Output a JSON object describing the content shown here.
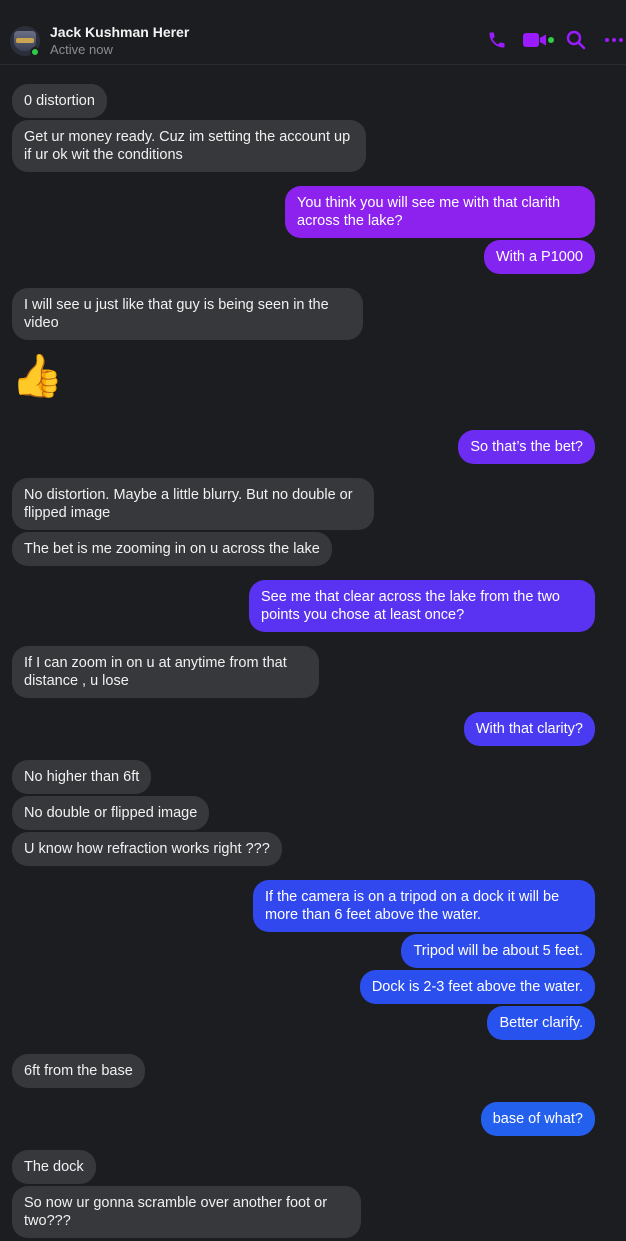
{
  "contact": {
    "name": "Jack Kushman Herer",
    "status": "Active now"
  },
  "colors": {
    "background": "#1c1d20",
    "incoming_bubble": "#37383b",
    "accent_purple": "#9b1bff",
    "online": "#31cc46"
  },
  "header_icons": [
    "phone-icon",
    "video-call-icon",
    "search-icon",
    "more-options-icon"
  ],
  "messages": [
    {
      "direction": "in",
      "text": "0 distortion"
    },
    {
      "direction": "in",
      "text": "Get ur money ready. Cuz im setting the account up if ur ok wit the conditions"
    },
    {
      "direction": "out",
      "text": "You think you will see me with that clarith across the lake?"
    },
    {
      "direction": "out",
      "text": "With a P1000"
    },
    {
      "direction": "in",
      "text": "I will see u just like that guy is being seen in the video"
    },
    {
      "direction": "in",
      "text": "👍"
    },
    {
      "direction": "out",
      "text": "So that’s the bet?"
    },
    {
      "direction": "in",
      "text": "No distortion. Maybe a little blurry. But no double or flipped image"
    },
    {
      "direction": "in",
      "text": "The bet is me zooming in on u across the lake"
    },
    {
      "direction": "out",
      "text": "See me that clear across the lake from the two points you chose at least once?"
    },
    {
      "direction": "in",
      "text": "If I can zoom in on u at anytime from that distance , u lose"
    },
    {
      "direction": "out",
      "text": "With that clarity?"
    },
    {
      "direction": "in",
      "text": "No higher than 6ft"
    },
    {
      "direction": "in",
      "text": "No double or flipped image"
    },
    {
      "direction": "in",
      "text": "U know how refraction works right ???"
    },
    {
      "direction": "out",
      "text": "If the camera is on a tripod on a dock it will be more than 6 feet above the water."
    },
    {
      "direction": "out",
      "text": "Tripod will be about 5 feet."
    },
    {
      "direction": "out",
      "text": "Dock is 2-3 feet above the water."
    },
    {
      "direction": "out",
      "text": "Better clarify."
    },
    {
      "direction": "in",
      "text": "6ft from the base"
    },
    {
      "direction": "out",
      "text": "base of what?"
    },
    {
      "direction": "in",
      "text": "The dock"
    },
    {
      "direction": "in",
      "text": "So now ur gonna scramble over another foot or two???"
    }
  ]
}
